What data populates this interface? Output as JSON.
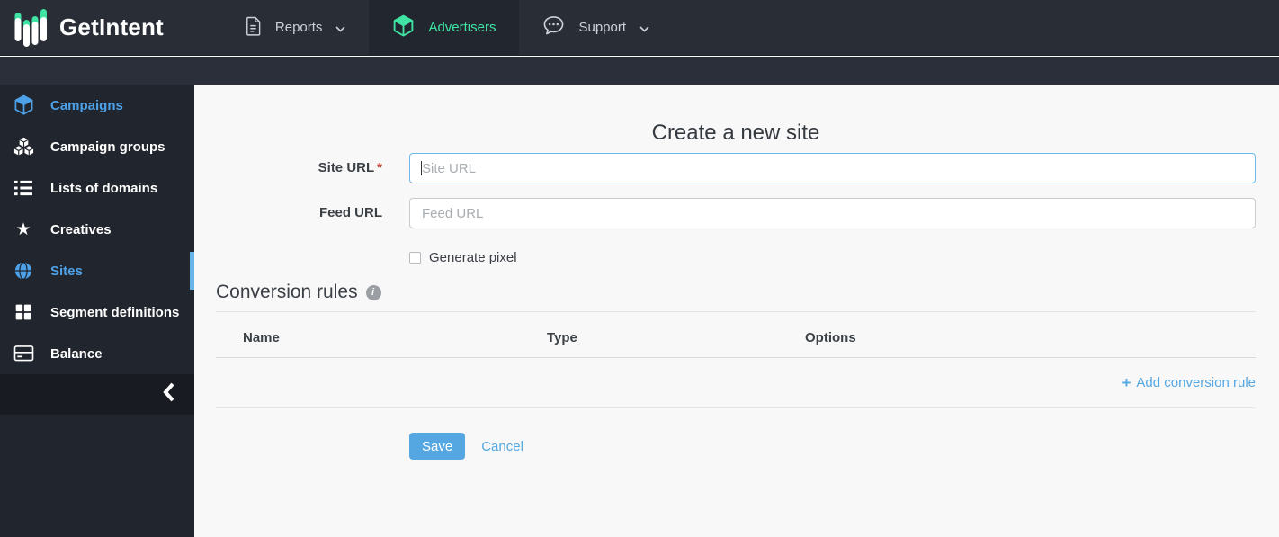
{
  "brand": {
    "name": "GetIntent",
    "logo_icon": "equalizer-bars-icon"
  },
  "navbar": {
    "items": [
      {
        "label": "Reports",
        "icon": "document-icon",
        "has_chevron": true,
        "active": false
      },
      {
        "label": "Advertisers",
        "icon": "cube-icon",
        "has_chevron": false,
        "active": true
      },
      {
        "label": "Support",
        "icon": "chat-icon",
        "has_chevron": true,
        "active": false
      }
    ]
  },
  "sidebar": {
    "items": [
      {
        "label": "Campaigns",
        "icon": "cube-icon",
        "highlighted": true,
        "current": false
      },
      {
        "label": "Campaign groups",
        "icon": "cubes-icon",
        "highlighted": false,
        "current": false
      },
      {
        "label": "Lists of domains",
        "icon": "list-icon",
        "highlighted": false,
        "current": false
      },
      {
        "label": "Creatives",
        "icon": "star-icon",
        "highlighted": false,
        "current": false
      },
      {
        "label": "Sites",
        "icon": "globe-icon",
        "highlighted": true,
        "current": true
      },
      {
        "label": "Segment definitions",
        "icon": "grid-icon",
        "highlighted": false,
        "current": false
      },
      {
        "label": "Balance",
        "icon": "card-icon",
        "highlighted": false,
        "current": false
      }
    ],
    "collapse_icon": "chevron-left-icon"
  },
  "main": {
    "title": "Create a new site",
    "required_mark": "*",
    "form": {
      "site_url": {
        "label": "Site URL",
        "required": true,
        "placeholder": "Site URL",
        "value": "",
        "focused": true
      },
      "feed_url": {
        "label": "Feed URL",
        "required": false,
        "placeholder": "Feed URL",
        "value": "",
        "focused": false
      },
      "generate_pixel": {
        "label": "Generate pixel",
        "checked": false
      }
    },
    "conversion_rules": {
      "title": "Conversion rules",
      "info_icon": "info-icon",
      "columns": [
        "Name",
        "Type",
        "Options"
      ],
      "rows": [],
      "add_plus": "+",
      "add_label": "Add conversion rule"
    },
    "actions": {
      "save": "Save",
      "cancel": "Cancel"
    }
  },
  "icons": {
    "star": "★",
    "info": "i"
  },
  "colors": {
    "brand_green": "#3fe3a3",
    "accent_blue": "#4da1e8",
    "link_blue": "#54a7e1",
    "navbar_bg": "#292d36",
    "subbar_bg": "#2b2f39",
    "sidebar_bg": "#21252d",
    "collapse_bg": "#181b21",
    "content_bg": "#f8f8f9",
    "active_bar": "#64b5e8",
    "save_bg": "#54a7e1",
    "required_red": "#c9453a",
    "focus_border": "#6db9ea"
  }
}
